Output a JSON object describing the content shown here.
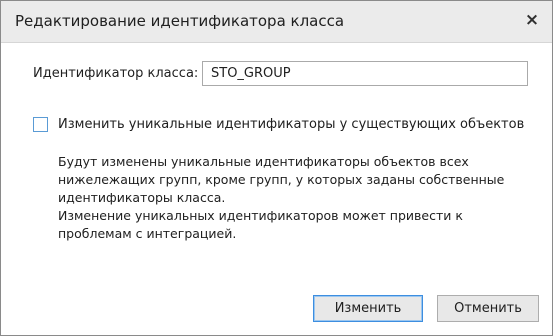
{
  "dialog": {
    "title": "Редактирование идентификатора класса",
    "close_label": "×"
  },
  "field": {
    "label": "Идентификатор класса:",
    "value": "STO_GROUP"
  },
  "checkbox": {
    "label": "Изменить уникальные идентификаторы у существующих объектов",
    "checked": false
  },
  "info": {
    "paragraph1": "Будут изменены уникальные идентификаторы объектов всех нижележащих групп, кроме групп, у которых заданы собственные идентификаторы класса.",
    "paragraph2": "Изменение уникальных идентификаторов может привести к проблемам с интеграцией."
  },
  "buttons": {
    "apply_label": "Изменить",
    "cancel_label": "Отменить"
  },
  "colors": {
    "accent": "#3d8ee0",
    "titlebar": "#ebebeb",
    "checkbox_border": "#5a9bd5"
  }
}
